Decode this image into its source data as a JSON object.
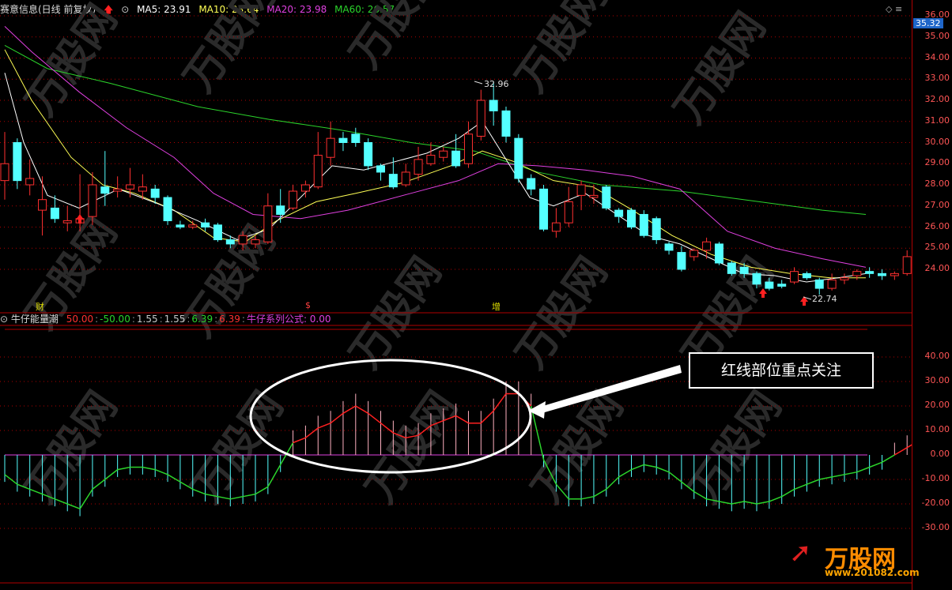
{
  "header": {
    "stock_name": "赛意信息(日线 前复权)",
    "ma5": "MA5: 23.91",
    "ma10": "MA10: 23.64",
    "ma20": "MA20: 23.98",
    "ma60": "MA60: 26.57",
    "ctrl_glyphs": "◇ ≡"
  },
  "price_axis": {
    "ticks": [
      "36.00",
      "35.00",
      "34.00",
      "33.00",
      "32.00",
      "31.00",
      "30.00",
      "29.00",
      "28.00",
      "27.00",
      "26.00",
      "25.00",
      "24.00"
    ],
    "current_price": "35.32"
  },
  "indicator": {
    "name": "牛仔能量潮",
    "values": [
      {
        "text": "50.00",
        "color": "#ff3030"
      },
      {
        "text": "-50.00",
        "color": "#2bd42b"
      },
      {
        "text": "1.55",
        "color": "#c8c8c8"
      },
      {
        "text": "1.55",
        "color": "#c8c8c8"
      },
      {
        "text": "6.39",
        "color": "#2bd42b"
      },
      {
        "text": "6.39",
        "color": "#ff3030"
      },
      {
        "text": "牛仔系列公式: 0.00",
        "color": "#e040e0"
      }
    ],
    "axis_ticks": [
      "40.00",
      "30.00",
      "20.00",
      "10.00",
      "0.00",
      "-10.00",
      "-20.00",
      "-30.00"
    ]
  },
  "annotations": {
    "high_label": "32.96",
    "low_label": "22.74",
    "markers": [
      "财",
      "$",
      "增"
    ],
    "callout_text": "红线部位重点关注"
  },
  "watermark": {
    "brand": "万股网",
    "site": "www.201082.com"
  },
  "colors": {
    "up": "#ff3030",
    "down": "#54ffff",
    "ma5": "#ffffff",
    "ma10": "#ffff55",
    "ma20": "#e040e0",
    "ma60": "#2bd42b",
    "grid": "#b00000"
  }
}
